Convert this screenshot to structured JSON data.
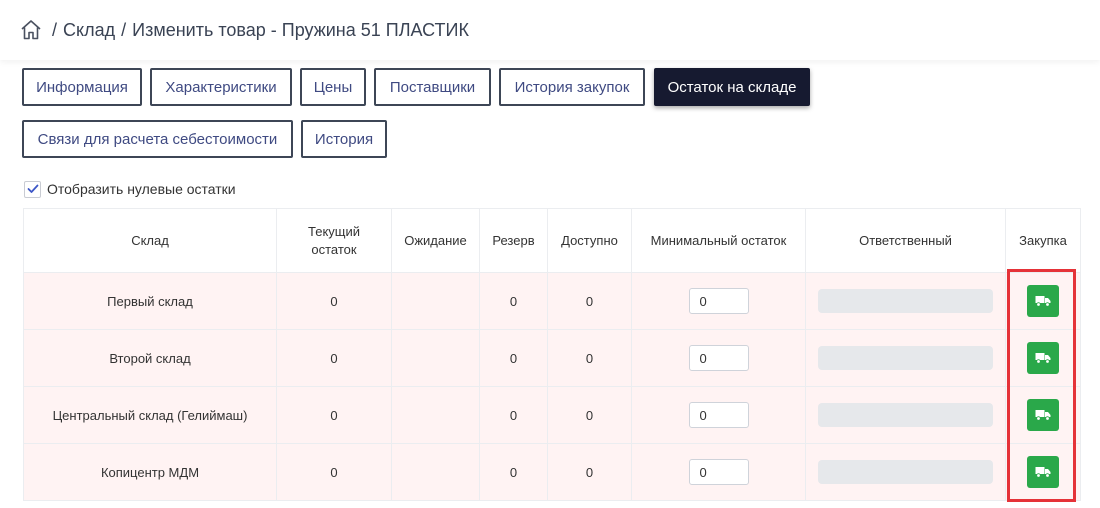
{
  "breadcrumb": {
    "home_icon": "home-icon",
    "items": [
      "Склад",
      "Изменить товар - Пружина 51 ПЛАСТИК"
    ]
  },
  "tabs": [
    {
      "label": "Информация",
      "active": false
    },
    {
      "label": "Характеристики",
      "active": false
    },
    {
      "label": "Цены",
      "active": false
    },
    {
      "label": "Поставщики",
      "active": false
    },
    {
      "label": "История закупок",
      "active": false
    },
    {
      "label": "Остаток на складе",
      "active": true
    },
    {
      "label": "Связи для расчета себестоимости",
      "active": false
    },
    {
      "label": "История",
      "active": false
    }
  ],
  "show_zero": {
    "label": "Отобразить нулевые остатки",
    "checked": true
  },
  "table": {
    "headers": {
      "warehouse": "Склад",
      "current_line1": "Текущий",
      "current_line2": "остаток",
      "waiting": "Ожидание",
      "reserve": "Резерв",
      "available": "Доступно",
      "min_stock": "Минимальный остаток",
      "responsible": "Ответственный",
      "purchase": "Закупка"
    },
    "rows": [
      {
        "warehouse": "Первый склад",
        "current": "0",
        "waiting": "",
        "reserve": "0",
        "available": "0",
        "min": "0"
      },
      {
        "warehouse": "Второй склад",
        "current": "0",
        "waiting": "",
        "reserve": "0",
        "available": "0",
        "min": "0"
      },
      {
        "warehouse": "Центральный склад (Гелиймаш)",
        "current": "0",
        "waiting": "",
        "reserve": "0",
        "available": "0",
        "min": "0"
      },
      {
        "warehouse": "Копицентр МДМ",
        "current": "0",
        "waiting": "",
        "reserve": "0",
        "available": "0",
        "min": "0"
      }
    ],
    "purchase_icon": "truck-icon"
  },
  "colors": {
    "active_tab": "#161a30",
    "tab_text": "#3f4a82",
    "row_bg": "#fff3f3",
    "purchase_button": "#2aa84a",
    "highlight": "#e53238"
  }
}
